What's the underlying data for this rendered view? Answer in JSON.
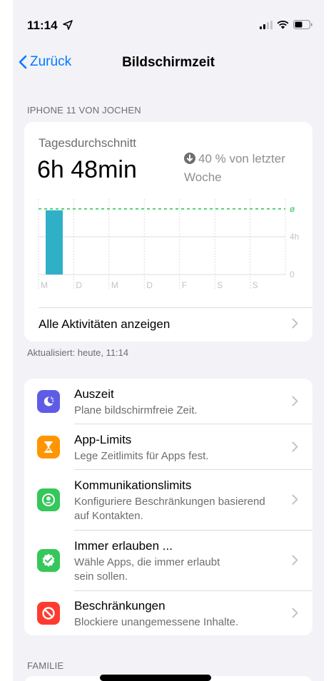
{
  "status": {
    "time": "11:14"
  },
  "nav": {
    "back_label": "Zurück",
    "title": "Bildschirmzeit"
  },
  "device_section": {
    "header": "IPHONE 11 VON JOCHEN",
    "avg_label": "Tagesdurchschnitt",
    "avg_value": "6h 48min",
    "delta_text": "40 % von letzter Woche",
    "all_activities": "Alle Aktivitäten anzeigen",
    "updated": "Aktualisiert: heute, 11:14"
  },
  "chart_data": {
    "type": "bar",
    "categories": [
      "M",
      "D",
      "M",
      "D",
      "F",
      "S",
      "S"
    ],
    "values": [
      6.8,
      0,
      0,
      0,
      0,
      0,
      0
    ],
    "ytick_labels": [
      "0",
      "4h"
    ],
    "ylim": [
      0,
      8
    ],
    "average_line_label": "ø",
    "average_value": 6.8,
    "bar_color": "#30b0c7",
    "average_color": "#34c759"
  },
  "settings": [
    {
      "title": "Auszeit",
      "subtitle": "Plane bildschirmfreie Zeit.",
      "icon": "downtime-icon",
      "color": "#5e5ce6"
    },
    {
      "title": "App-Limits",
      "subtitle": "Lege Zeitlimits für Apps fest.",
      "icon": "hourglass-icon",
      "color": "#ff9500"
    },
    {
      "title": "Kommunikationslimits",
      "subtitle": "Konfiguriere Beschränkungen basierend auf Kontakten.",
      "icon": "contact-icon",
      "color": "#34c759"
    },
    {
      "title": "Immer erlauben ...",
      "subtitle": "Wähle Apps, die immer erlaubt sein sollen.",
      "icon": "checkmark-badge-icon",
      "color": "#34c759"
    },
    {
      "title": "Beschränkungen",
      "subtitle": "Blockiere unangemessene Inhalte.",
      "icon": "restriction-icon",
      "color": "#ff3b30"
    }
  ],
  "family_section": {
    "header": "FAMILIE"
  }
}
